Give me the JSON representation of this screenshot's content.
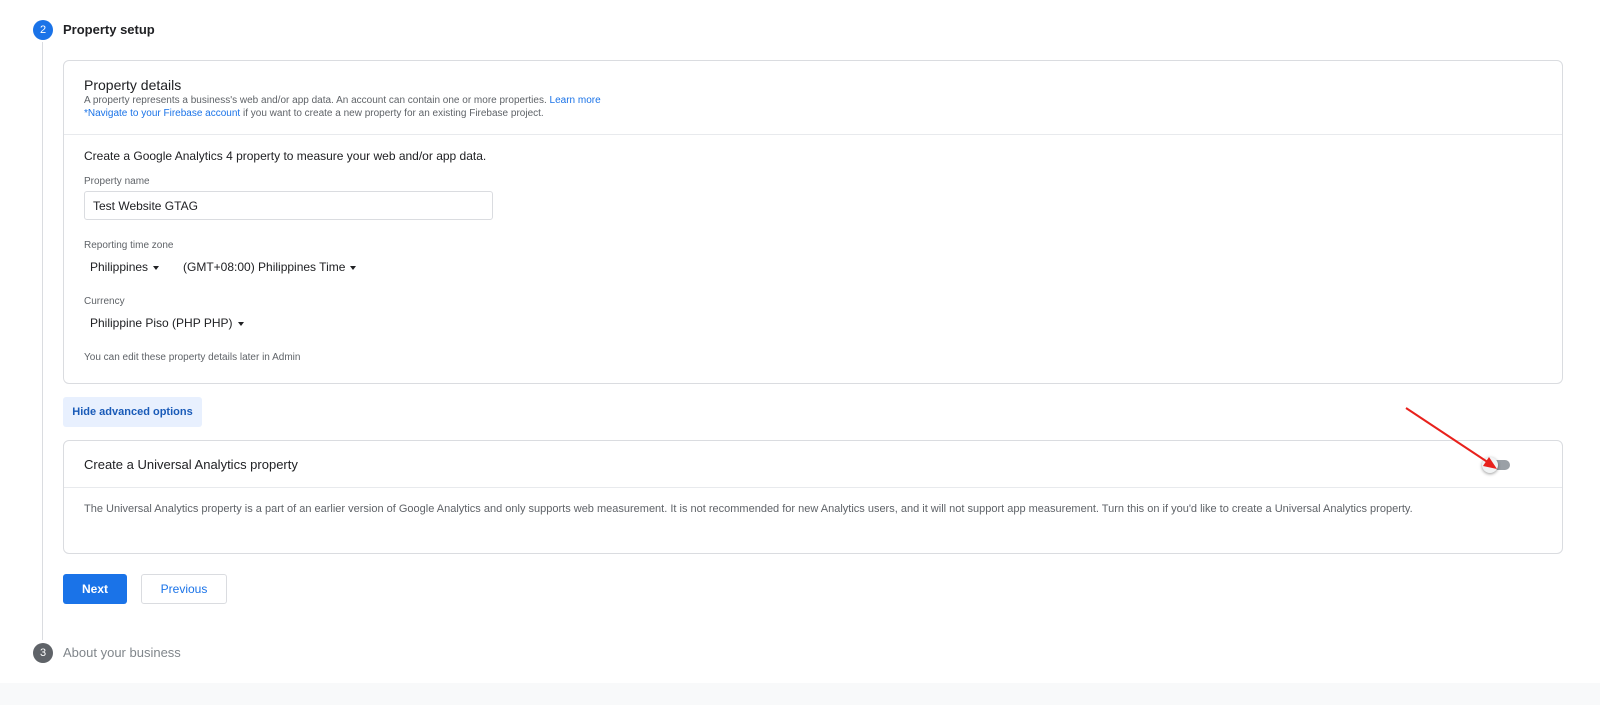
{
  "steps": {
    "current": {
      "number": "2",
      "title": "Property setup"
    },
    "next": {
      "number": "3",
      "title": "About your business"
    }
  },
  "property_details": {
    "title": "Property details",
    "description": "A property represents a business's web and/or app data. An account can contain one or more properties.",
    "learn_more": "Learn more",
    "firebase_link": "*Navigate to your Firebase account",
    "firebase_suffix": " if you want to create a new property for an existing Firebase project.",
    "intro": "Create a Google Analytics 4 property to measure your web and/or app data.",
    "property_name_label": "Property name",
    "property_name_value": "Test Website GTAG",
    "timezone_label": "Reporting time zone",
    "country_value": "Philippines",
    "timezone_value": "(GMT+08:00) Philippines Time",
    "currency_label": "Currency",
    "currency_value": "Philippine Piso (PHP PHP)",
    "footnote": "You can edit these property details later in Admin"
  },
  "advanced_button": "Hide advanced options",
  "universal_analytics": {
    "title": "Create a Universal Analytics property",
    "toggle_on": false,
    "description": "The Universal Analytics property is a part of an earlier version of Google Analytics and only supports web measurement. It is not recommended for new Analytics users, and it will not support app measurement. Turn this on if you'd like to create a Universal Analytics property."
  },
  "buttons": {
    "next": "Next",
    "previous": "Previous"
  },
  "colors": {
    "accent": "#1a73e8",
    "annotation_arrow": "#e8211c"
  }
}
